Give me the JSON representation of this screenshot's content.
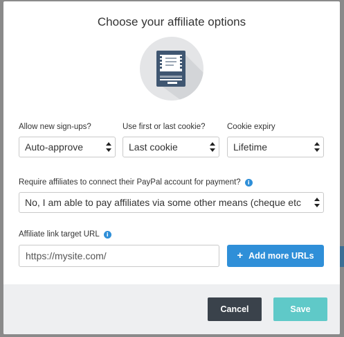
{
  "modal": {
    "title": "Choose your affiliate options"
  },
  "signups": {
    "label": "Allow new sign-ups?",
    "value": "Auto-approve"
  },
  "cookie_choice": {
    "label": "Use first or last cookie?",
    "value": "Last cookie"
  },
  "cookie_expiry": {
    "label": "Cookie expiry",
    "value": "Lifetime"
  },
  "paypal": {
    "label": "Require affiliates to connect their PayPal account for payment?",
    "value": "No, I am able to pay affiliates via some other means (cheque etc"
  },
  "link_url": {
    "label": "Affiliate link target URL",
    "placeholder": "https://mysite.com/",
    "add_button": "Add more URLs"
  },
  "footer": {
    "cancel_label": "Cancel",
    "save_label": "Save"
  },
  "colors": {
    "primary_blue": "#2f8fd8",
    "cancel_dark": "#3a424b",
    "save_teal": "#5fc9c8",
    "footer_bg": "#eeeff1",
    "overlay": "#7f7f7f"
  },
  "icons": {
    "hero": "atm-machine-icon",
    "info": "info-icon",
    "plus": "plus-icon",
    "select_arrows": "select-arrows-icon"
  }
}
